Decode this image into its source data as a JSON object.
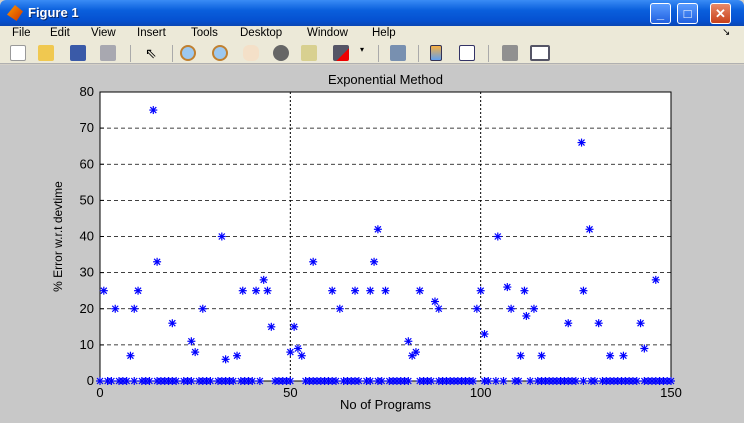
{
  "window": {
    "title": "Figure 1",
    "minimize": "_",
    "maximize": "□",
    "close": "✕"
  },
  "menu": [
    "File",
    "Edit",
    "View",
    "Insert",
    "Tools",
    "Desktop",
    "Window",
    "Help"
  ],
  "toolbar": [
    "new-file-icon",
    "open-folder-icon",
    "save-icon",
    "print-icon",
    "pointer-icon",
    "zoom-in-icon",
    "zoom-out-icon",
    "pan-hand-icon",
    "rotate-3d-icon",
    "data-cursor-icon",
    "brush-icon",
    "link-plot-icon",
    "colorbar-icon",
    "legend-icon",
    "hide-plot-tools-icon",
    "show-plot-tools-icon"
  ],
  "colors": {
    "marker": "#0000ff",
    "accent": "#0a5fdc"
  },
  "chart_data": {
    "type": "scatter",
    "title": "Exponential Method",
    "xlabel": "No of Programs",
    "ylabel": "% Error w.r.t devtime",
    "xlim": [
      0,
      150
    ],
    "ylim": [
      0,
      80
    ],
    "xticks": [
      0,
      50,
      100,
      150
    ],
    "yticks": [
      0,
      10,
      20,
      30,
      40,
      50,
      60,
      70,
      80
    ],
    "grid": "dashed",
    "marker": "*",
    "points": [
      [
        1,
        25
      ],
      [
        4,
        20
      ],
      [
        8,
        7
      ],
      [
        9,
        20
      ],
      [
        10,
        25
      ],
      [
        14,
        75
      ],
      [
        15,
        33
      ],
      [
        19,
        16
      ],
      [
        24,
        11
      ],
      [
        25,
        8
      ],
      [
        27,
        20
      ],
      [
        32,
        40
      ],
      [
        33,
        6
      ],
      [
        36,
        7
      ],
      [
        37.5,
        25
      ],
      [
        41,
        25
      ],
      [
        43,
        28
      ],
      [
        44,
        25
      ],
      [
        45,
        15
      ],
      [
        50,
        8
      ],
      [
        51,
        15
      ],
      [
        52,
        9
      ],
      [
        53,
        7
      ],
      [
        56,
        33
      ],
      [
        61,
        25
      ],
      [
        63,
        20
      ],
      [
        67,
        25
      ],
      [
        71,
        25
      ],
      [
        72,
        33
      ],
      [
        73,
        42
      ],
      [
        75,
        25
      ],
      [
        81,
        11
      ],
      [
        82,
        7
      ],
      [
        83,
        8
      ],
      [
        84,
        25
      ],
      [
        88,
        22
      ],
      [
        89,
        20
      ],
      [
        99,
        20
      ],
      [
        100,
        25
      ],
      [
        101,
        13
      ],
      [
        104.5,
        40
      ],
      [
        107,
        26
      ],
      [
        108,
        20
      ],
      [
        110.5,
        7
      ],
      [
        111.5,
        25
      ],
      [
        112,
        18
      ],
      [
        114,
        20
      ],
      [
        116,
        7
      ],
      [
        123,
        16
      ],
      [
        126.5,
        66
      ],
      [
        127,
        25
      ],
      [
        128.6,
        42
      ],
      [
        131,
        16
      ],
      [
        134,
        7
      ],
      [
        137.5,
        7
      ],
      [
        142,
        16
      ],
      [
        143,
        9
      ],
      [
        146,
        28
      ]
    ],
    "zero_x": [
      0,
      2,
      3,
      5,
      6,
      7,
      9,
      11,
      12,
      13,
      15,
      16,
      17,
      18,
      19,
      20,
      22,
      23,
      24,
      26,
      27,
      28,
      29,
      31,
      32,
      33,
      34,
      35,
      37,
      38,
      39,
      40,
      42,
      46,
      47,
      48,
      49,
      50,
      54,
      55,
      56,
      57,
      58,
      59,
      60,
      61,
      62,
      64,
      65,
      66,
      67,
      68,
      70,
      71,
      73,
      74,
      76,
      77,
      78,
      79,
      80,
      81,
      84,
      85,
      86,
      87,
      89,
      90,
      91,
      92,
      93,
      94,
      95,
      96,
      97,
      98,
      101,
      102,
      104,
      106,
      109,
      110,
      113,
      115,
      116,
      117,
      118,
      119,
      120,
      121,
      122,
      123,
      124,
      125,
      127,
      129,
      130,
      132,
      133,
      134,
      135,
      136,
      137,
      138,
      139,
      140,
      141,
      143,
      144,
      145,
      146,
      147,
      148,
      149,
      150
    ]
  }
}
